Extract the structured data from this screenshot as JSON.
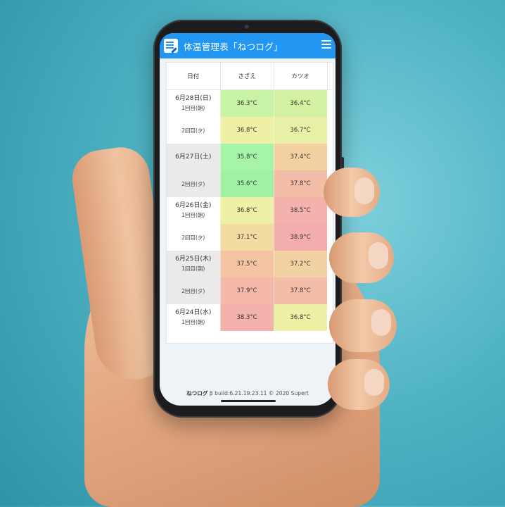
{
  "app": {
    "title": "体温管理表「ねつログ」"
  },
  "table": {
    "headers": [
      "日付",
      "さざえ",
      "カツオ"
    ],
    "rows": [
      {
        "date": "6月28日(日)",
        "session": "1回目(朝)",
        "values": [
          "36.3°C",
          "36.4°C"
        ],
        "colors": [
          "#c8f2a4",
          "#d4f0a2"
        ],
        "shade": false
      },
      {
        "date": "",
        "session": "2回目(夕)",
        "values": [
          "36.8°C",
          "36.7°C"
        ],
        "colors": [
          "#eef0a6",
          "#e8efa6"
        ],
        "shade": false
      },
      {
        "date": "6月27日(土)",
        "session": "",
        "values": [
          "35.8°C",
          "37.4°C"
        ],
        "colors": [
          "#a6f4a8",
          "#f2d0a0"
        ],
        "shade": true
      },
      {
        "date": "",
        "session": "2回目(夕)",
        "values": [
          "35.6°C",
          "37.8°C"
        ],
        "colors": [
          "#a0f1a4",
          "#f4bda8"
        ],
        "shade": true
      },
      {
        "date": "6月26日(金)",
        "session": "1回目(朝)",
        "values": [
          "36.8°C",
          "38.5°C"
        ],
        "colors": [
          "#eef0a6",
          "#f3b2ac"
        ],
        "shade": false
      },
      {
        "date": "",
        "session": "2回目(夕)",
        "values": [
          "37.1°C",
          "38.9°C"
        ],
        "colors": [
          "#f3dca2",
          "#f3adac"
        ],
        "shade": false
      },
      {
        "date": "6月25日(木)",
        "session": "1回目(朝)",
        "values": [
          "37.5°C",
          "37.2°C"
        ],
        "colors": [
          "#f4c4a4",
          "#f2d2a2"
        ],
        "shade": true
      },
      {
        "date": "",
        "session": "2回目(夕)",
        "values": [
          "37.9°C",
          "37.8°C"
        ],
        "colors": [
          "#f4b9aa",
          "#f4bda8"
        ],
        "shade": true
      },
      {
        "date": "6月24日(水)",
        "session": "1回目(朝)",
        "values": [
          "38.3°C",
          "36.8°C"
        ],
        "colors": [
          "#f3b3ac",
          "#eef0a6"
        ],
        "shade": false
      }
    ]
  },
  "footer": {
    "app_name": "ねつログ",
    "rest": " β build:6.21.19.23.11 © 2020 Supert"
  }
}
